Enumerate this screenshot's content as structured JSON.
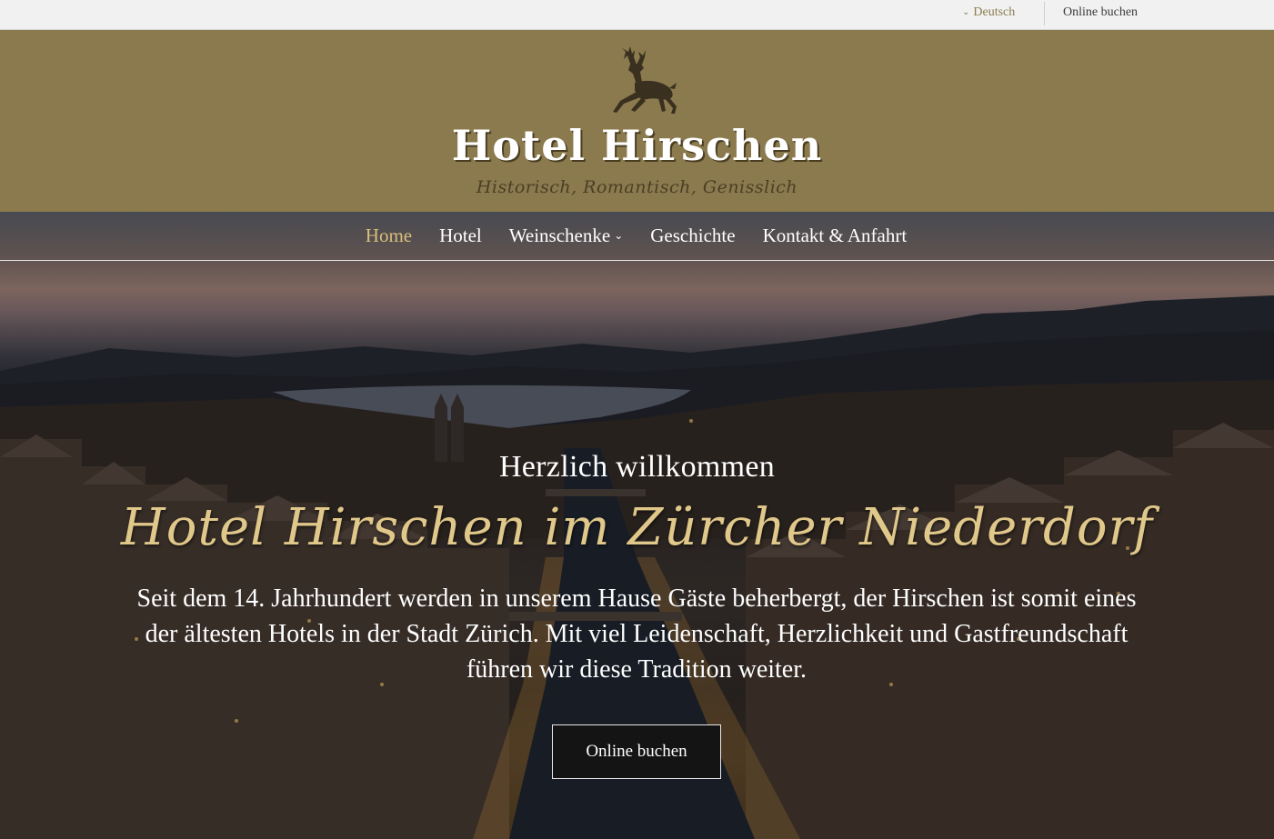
{
  "topbar": {
    "language": "Deutsch",
    "book_label": "Online buchen"
  },
  "brand": {
    "name": "Hotel Hirschen",
    "tagline": "Historisch, Romantisch, Genisslich"
  },
  "nav": {
    "items": [
      {
        "label": "Home"
      },
      {
        "label": "Hotel"
      },
      {
        "label": "Weinschenke"
      },
      {
        "label": "Geschichte"
      },
      {
        "label": "Kontakt & Anfahrt"
      }
    ]
  },
  "hero": {
    "welcome": "Herzlich willkommen",
    "title": "Hotel Hirschen im Zürcher Niederdorf",
    "intro": "Seit dem 14. Jahrhundert werden in unserem Hause Gäste beherbergt, der Hirschen ist somit eines der ältesten Hotels in der Stadt Zürich. Mit viel Leidenschaft, Herzlichkeit und Gastfreundschaft führen wir diese Tradition weiter.",
    "cta_label": "Online buchen"
  },
  "colors": {
    "brand_band": "#8b7a4e",
    "accent_gold": "#d8bf7c",
    "script_gold": "#e0c78a",
    "topbar_bg": "#f1f1f1"
  }
}
